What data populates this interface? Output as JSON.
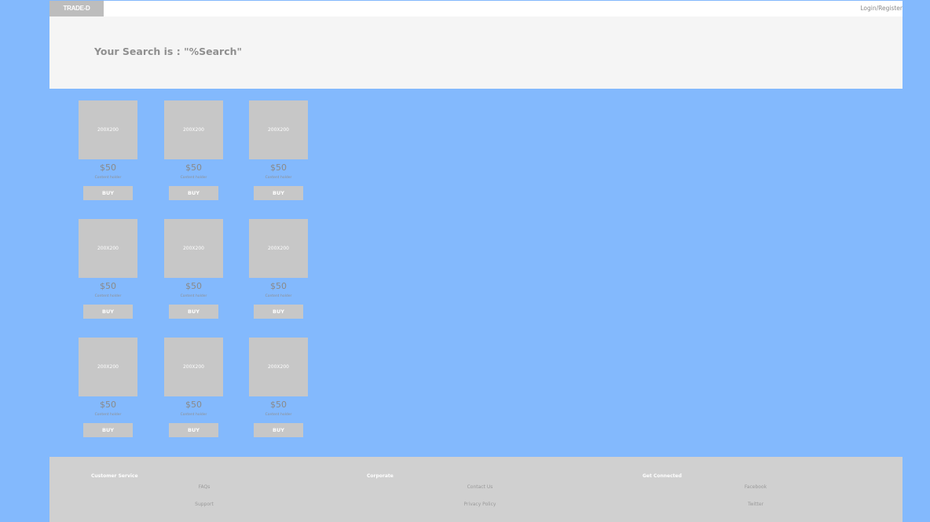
{
  "header": {
    "logo_text": "TRADE-D",
    "login_label": "Login/Register"
  },
  "hero": {
    "search_heading": "Your Search is : \"%Search\""
  },
  "products": [
    {
      "image_label": "200X200",
      "price": "$50",
      "description": "Content holder",
      "buy_label": "BUY"
    },
    {
      "image_label": "200X200",
      "price": "$50",
      "description": "Content holder",
      "buy_label": "BUY"
    },
    {
      "image_label": "200X200",
      "price": "$50",
      "description": "Content holder",
      "buy_label": "BUY"
    },
    {
      "image_label": "200X200",
      "price": "$50",
      "description": "Content holder",
      "buy_label": "BUY"
    },
    {
      "image_label": "200X200",
      "price": "$50",
      "description": "Content holder",
      "buy_label": "BUY"
    },
    {
      "image_label": "200X200",
      "price": "$50",
      "description": "Content holder",
      "buy_label": "BUY"
    },
    {
      "image_label": "200X200",
      "price": "$50",
      "description": "Content holder",
      "buy_label": "BUY"
    },
    {
      "image_label": "200X200",
      "price": "$50",
      "description": "Content holder",
      "buy_label": "BUY"
    },
    {
      "image_label": "200X200",
      "price": "$50",
      "description": "Content holder",
      "buy_label": "BUY"
    }
  ],
  "footer": {
    "columns": [
      {
        "heading": "Customer Service",
        "links": [
          "FAQs",
          "Support"
        ]
      },
      {
        "heading": "Corporate",
        "links": [
          "Contact Us",
          "Privacy Policy"
        ]
      },
      {
        "heading": "Get Connected",
        "links": [
          "Facebook",
          "Twitter"
        ]
      }
    ]
  },
  "colors": {
    "page_background": "#83b9fd",
    "placeholder_gray": "#c7c7c7",
    "hero_background": "#f5f5f5",
    "footer_background": "#d0d0d0"
  }
}
